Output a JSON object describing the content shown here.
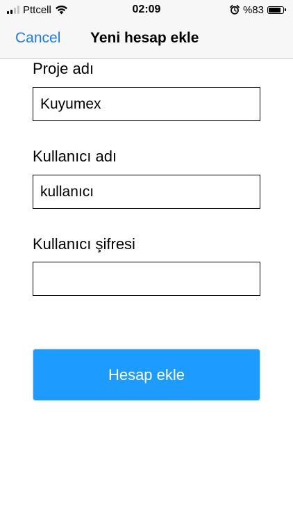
{
  "status_bar": {
    "carrier": "Pttcell",
    "time": "02:09",
    "battery_text": "%83",
    "battery_level": 0.83,
    "icons": [
      "signal-icon",
      "wifi-icon",
      "alarm-icon",
      "battery-icon"
    ]
  },
  "nav": {
    "cancel_label": "Cancel",
    "title": "Yeni hesap ekle"
  },
  "form": {
    "project": {
      "label": "Proje adı",
      "value": "Kuyumex"
    },
    "username": {
      "label": "Kullanıcı adı",
      "value": "kullanıcı"
    },
    "password": {
      "label": "Kullanıcı şifresi",
      "value": ""
    },
    "submit_label": "Hesap ekle"
  },
  "colors": {
    "accent": "#1a7cf0",
    "button": "#1e9bff",
    "bar_background": "#f7f7f7"
  }
}
